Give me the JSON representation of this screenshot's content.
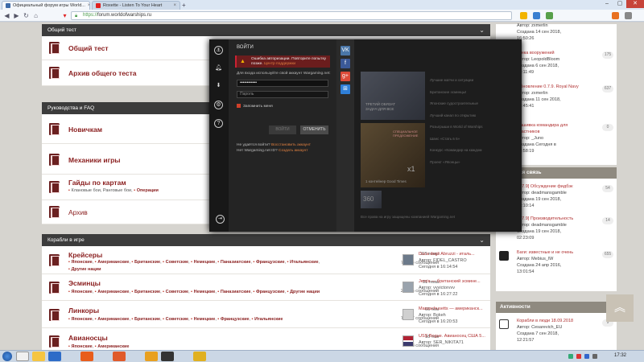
{
  "browser": {
    "tabs": [
      {
        "label": "Официальный форум игры World...",
        "icon_color": "#3d6aa8"
      },
      {
        "label": "Roxette - Listen To Your Heart",
        "icon_color": "#e02020"
      }
    ],
    "new_tab": "+",
    "url_scheme": "https://",
    "url_host": "forum.worldofwarships.ru",
    "window_controls": [
      "–",
      "▢",
      "✕"
    ]
  },
  "main": {
    "sections": [
      {
        "title": "Общий тест",
        "forums": [
          {
            "title": "Общий тест",
            "subs": []
          },
          {
            "title": "Архив общего теста",
            "subs": []
          }
        ]
      },
      {
        "title": "Руководства и FAQ",
        "forums": [
          {
            "title": "Новичкам",
            "subs": []
          },
          {
            "title": "Механики игры",
            "subs": []
          },
          {
            "title": "Гайды по картам",
            "subs": [
              "Клановые бои",
              "Ранговые бои",
              "Операции"
            ]
          },
          {
            "title": "Архив",
            "subs": []
          }
        ]
      },
      {
        "title": "Корабли в игре",
        "forums": [
          {
            "title": "Крейсеры",
            "subs": [
              "Японские",
              "Американские",
              "Британские",
              "Советские",
              "Немецкие",
              "Паназиатские",
              "Французские",
              "Итальянские",
              "Другие нации"
            ],
            "topics": "113 темы",
            "posts": "75 064 сообщения",
            "last_title": "Duca degli Abruzzi - италь...",
            "last_author": "Автор: FIDEL_CASTRO",
            "last_date": "Сегодня в 16:14:54"
          },
          {
            "title": "Эсминцы",
            "subs": [
              "Японские",
              "Американские",
              "Британские",
              "Советские",
              "Немецкие",
              "Паназиатские",
              "Французские",
              "Другие нации"
            ],
            "topics": "91 тема",
            "posts": "27 685 сообщений",
            "last_title": "Jervis — британский эсмине...",
            "last_author": "Автор: vvvictorvvv",
            "last_date": "Сегодня в 16:27:22"
          },
          {
            "title": "Линкоры",
            "subs": [
              "Японские",
              "Американские",
              "Британские",
              "Советские",
              "Немецкие",
              "Французские",
              "Итальянские"
            ],
            "topics": "66 тем",
            "posts": "76 157 сообщений",
            "last_title": "Massachusetts — американск...",
            "last_author": "Автор: Bokeh",
            "last_date": "Сегодня в 16:20:53"
          },
          {
            "title": "Авианосцы",
            "subs": [
              "Японские",
              "Американские"
            ],
            "topics": "18 тем",
            "posts": "9 053 сообщения",
            "last_title": "USS Bogue. Авианосец США 5...",
            "last_author": "Автор: SER_NIKITA71",
            "last_date": ""
          }
        ]
      }
    ]
  },
  "sidebar": {
    "top_items": [
      {
        "title": "",
        "author": "Автор: zxmerlin",
        "date": "Создана 14 сен 2018,",
        "time": "16:50:26",
        "count": ""
      },
      {
        "title": "Гонка вооружений",
        "author": "Автор: LeopoldBloom",
        "date": "Создана 6 сен 2018,",
        "time": "12:11:49",
        "count": "175"
      },
      {
        "title": "Обновление 0.7.9. Royal Navy",
        "author": "Автор: zxmerlin",
        "date": "Создана 11 сен 2018,",
        "time": "16:45:41",
        "count": "637"
      },
      {
        "title": "Нашивка командира для участников",
        "author": "Автор: _Juno",
        "date": "Создана Сегодня в",
        "time": "14:58:19",
        "count": "0"
      }
    ],
    "feedback_header": "Обратная связь",
    "feedback_items": [
      {
        "title": "[0.7.9] Обсуждение фидбэк",
        "author": "Автор: deadmansgamble",
        "date": "Создана 19 сен 2018,",
        "time": "02:10:14",
        "count": "54"
      },
      {
        "title": "[0.7.9] Производительность",
        "author": "Автор: deadmansgamble",
        "date": "Создана 19 сен 2018,",
        "time": "02:23:09",
        "count": "14"
      },
      {
        "title": "Баги: известные и не очень",
        "author": "Автор: Mebius_lW",
        "date": "Создана 24 апр 2016,",
        "time": "13:01:54",
        "count": "655"
      }
    ],
    "activity_header": "Активности",
    "activity_items": [
      {
        "title": "Корабли в люди 18.09.2018",
        "author": "Автор: Cesarevich_EU",
        "date": "Создана 7 сен 2018,",
        "time": "12:21:57",
        "count": "9"
      }
    ],
    "scroll_top": "︽"
  },
  "overlay": {
    "login_title": "ВОЙТИ",
    "error_text_1": "Ошибка авторизации. Повторите попытку",
    "error_text_2": "позже.",
    "error_link": "Центр поддержки",
    "hint": "Для входа используйте свой аккаунт Wargaming.net:",
    "email_value": "••••••••••••",
    "password_placeholder": "Пароль",
    "remember_label": "Запомнить меня",
    "login_button": "ВОЙТИ",
    "cancel_button": "ОТМЕНИТЬ",
    "no_login_text": "Не удаётся войти?",
    "restore_link": "Восстановить аккаунт",
    "no_account_text": "Нет Wargaming.net ID?",
    "create_link": "Создать аккаунт",
    "social": [
      {
        "name": "vk-icon",
        "glyph": "VK",
        "color": "#4a76a8"
      },
      {
        "name": "facebook-icon",
        "glyph": "f",
        "color": "#3b5998"
      },
      {
        "name": "google-plus-icon",
        "glyph": "g+",
        "color": "#dd4b39"
      },
      {
        "name": "windows-icon",
        "glyph": "⊞",
        "color": "#2f7fd8"
      }
    ],
    "promo_1_line1": "ТРЕТИЙ ОБЯЗАТ",
    "promo_1_line2": "ЗАДАЧ ДЛЯ ВСЕ",
    "promo_2_badge": "СПЕЦИАЛЬНОЕ",
    "promo_2_badge2": "ПРЕДЛОЖЕНИЕ",
    "promo_2_count": "x1",
    "promo_2_caption": "1 контейнер Good Times",
    "promo_3_label": "360",
    "feed": [
      "Лучшие матчи и ситуации",
      "Британские эсминцы!",
      "Японские судостроительные",
      "Лучший канал по открытию",
      "Розыгрыши в World of Warships",
      "Шанс «Стать в 5»",
      "Конкурс «Командир на каждом",
      "Проект «Японцы»"
    ],
    "bottom_note": "Все права на игру защищены компанией Wargaming.net"
  },
  "taskbar": {
    "clock": "17:32"
  }
}
